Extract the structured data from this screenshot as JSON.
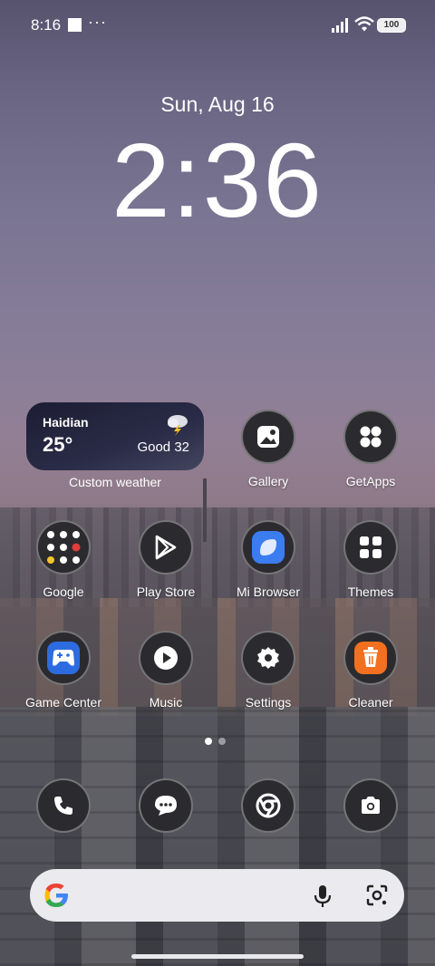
{
  "status_bar": {
    "time": "8:16",
    "overflow": "···",
    "battery": "100"
  },
  "lockscreen": {
    "date": "Sun, Aug 16",
    "time": "2:36"
  },
  "weather_widget": {
    "city": "Haidian",
    "temperature": "25°",
    "air_quality": "Good 32",
    "label": "Custom weather"
  },
  "apps": [
    {
      "label": "Gallery",
      "icon": "gallery-icon"
    },
    {
      "label": "GetApps",
      "icon": "grid-icon"
    },
    {
      "label": "Google",
      "icon": "folder-icon"
    },
    {
      "label": "Play Store",
      "icon": "play-store-icon"
    },
    {
      "label": "Mi Browser",
      "icon": "browser-icon"
    },
    {
      "label": "Themes",
      "icon": "themes-icon"
    },
    {
      "label": "Game Center",
      "icon": "gamepad-icon"
    },
    {
      "label": "Music",
      "icon": "music-play-icon"
    },
    {
      "label": "Settings",
      "icon": "gear-icon"
    },
    {
      "label": "Cleaner",
      "icon": "trash-icon"
    }
  ],
  "dock": [
    "phone-icon",
    "messages-icon",
    "chrome-icon",
    "camera-icon"
  ],
  "colors": {
    "browser_blue": "#3b7cf0",
    "game_blue": "#2d6ce0",
    "cleaner_orange": "#f2701f",
    "page_dot_active": "#ffffff",
    "page_dot_inactive": "#9a9aa0"
  }
}
